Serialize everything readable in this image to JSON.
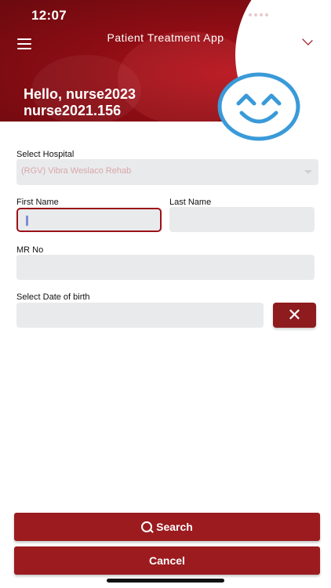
{
  "status_bar": {
    "time": "12:07"
  },
  "header": {
    "app_title": "Patient Treatment App",
    "greeting_line1": "Hello, nurse2023",
    "greeting_line2": "nurse2021.156"
  },
  "icons": {
    "menu": "menu-icon",
    "mail": "mail-icon",
    "smiley": "smiley-face-icon",
    "clear": "close-icon",
    "search": "search-icon"
  },
  "colors": {
    "primary": "#9b1b1e",
    "header": "#8e0d14",
    "field": "#e9eaec",
    "smiley": "#3a9ad9"
  },
  "form": {
    "hospital": {
      "label": "Select Hospital",
      "value": "(RGV) Vibra Weslaco Rehab"
    },
    "first_name": {
      "label": "First Name",
      "value": ""
    },
    "last_name": {
      "label": "Last Name",
      "value": ""
    },
    "mr_no": {
      "label": "MR No",
      "value": ""
    },
    "dob": {
      "label": "Select Date of birth",
      "value": ""
    },
    "clear_label": "✕"
  },
  "actions": {
    "search_label": "Search",
    "cancel_label": "Cancel"
  }
}
